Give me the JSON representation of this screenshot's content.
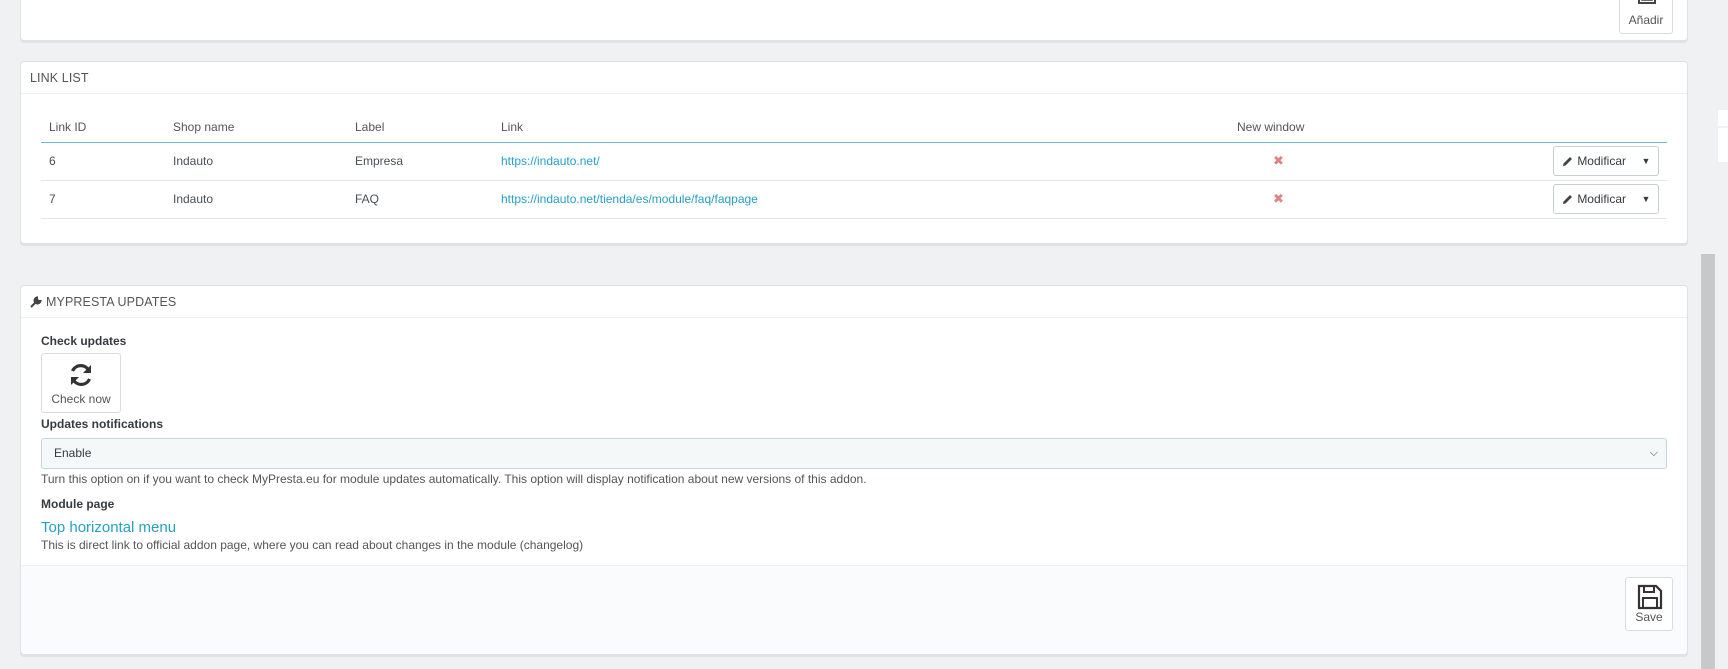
{
  "top_panel": {
    "add_label": "Añadir"
  },
  "link_list": {
    "title": "LINK LIST",
    "columns": [
      "Link ID",
      "Shop name",
      "Label",
      "Link",
      "New window"
    ],
    "rows": [
      {
        "id": "6",
        "shop": "Indauto",
        "label": "Empresa",
        "link": "https://indauto.net/",
        "new_window": "✖",
        "action": "Modificar"
      },
      {
        "id": "7",
        "shop": "Indauto",
        "label": "FAQ",
        "link": "https://indauto.net/tienda/es/module/faq/faqpage",
        "new_window": "✖",
        "action": "Modificar"
      }
    ]
  },
  "updates": {
    "title": "MYPRESTA UPDATES",
    "check_label": "Check updates",
    "check_button": "Check now",
    "notif_label": "Updates notifications",
    "notif_value": "Enable",
    "notif_help": "Turn this option on if you want to check MyPresta.eu for module updates automatically. This option will display notification about new versions of this addon.",
    "module_label": "Module page",
    "module_link": "Top horizontal menu",
    "module_help": "This is direct link to official addon page, where you can read about changes in the module (changelog)",
    "save_label": "Save"
  }
}
